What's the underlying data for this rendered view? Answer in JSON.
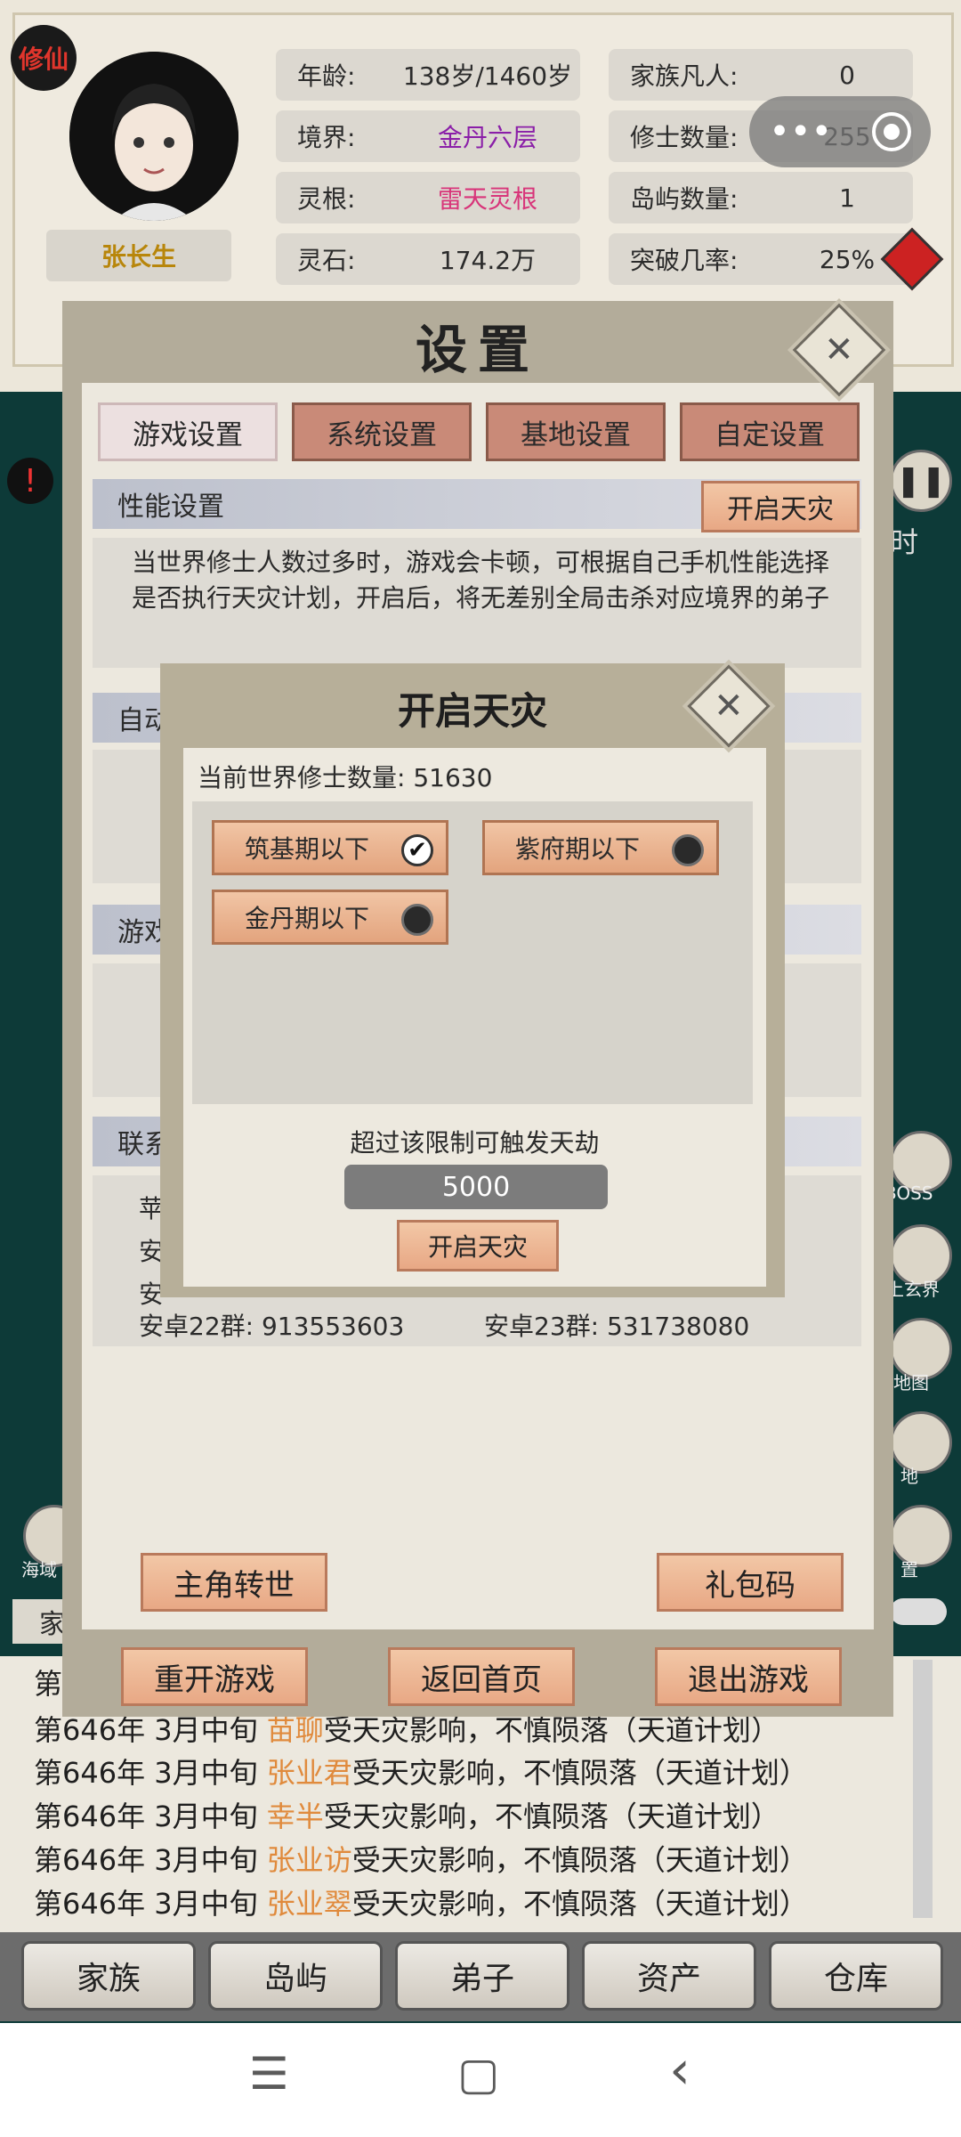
{
  "header": {
    "badge": "修仙",
    "player_name": "张长生",
    "stats": [
      {
        "key": "年龄:",
        "value": "138岁/1460岁"
      },
      {
        "key": "境界:",
        "value": "金丹六层"
      },
      {
        "key": "灵根:",
        "value": "雷天灵根"
      },
      {
        "key": "灵石:",
        "value": "174.2万"
      },
      {
        "key": "家族凡人:",
        "value": "0"
      },
      {
        "key": "修士数量:",
        "value": "255"
      },
      {
        "key": "岛屿数量:",
        "value": "1"
      },
      {
        "key": "突破几率:",
        "value": "25%"
      }
    ],
    "colors": {
      "realm": "#8a1ea8",
      "root": "#d8357a"
    }
  },
  "side": {
    "right_labels": [
      "BOSS",
      "上玄界",
      "地图",
      "地",
      "置"
    ],
    "left_label": "海域",
    "time_char": "时"
  },
  "settings": {
    "title": "设置",
    "tabs": [
      "游戏设置",
      "系统设置",
      "基地设置",
      "自定设置"
    ],
    "active_tab": 0,
    "perf_section": "性能设置",
    "perf_button": "开启天灾",
    "perf_desc": "当世界修士人数过多时，游戏会卡顿，可根据自己手机性能选择是否执行天灾计划，开启后，将无差别全局击杀对应境界的弟子",
    "hidden_sections": [
      "自动",
      "游戏",
      "联系"
    ],
    "contact_partial": [
      "苹",
      "安",
      "安"
    ],
    "qq_groups": [
      "安卓22群: 913553603",
      "安卓23群: 531738080"
    ],
    "bottom_buttons": [
      "主角转世",
      "礼包码"
    ],
    "footer_buttons": [
      "重开游戏",
      "返回首页",
      "退出游戏"
    ]
  },
  "dialog": {
    "title": "开启天灾",
    "world_count": "当前世界修士数量: 51630",
    "options": [
      {
        "label": "筑基期以下",
        "checked": true
      },
      {
        "label": "紫府期以下",
        "checked": false
      },
      {
        "label": "金丹期以下",
        "checked": false
      }
    ],
    "limit_label": "超过该限制可触发天劫",
    "limit_value": "5000",
    "confirm": "开启天灾"
  },
  "log": {
    "tab_partial": "家",
    "lines": [
      {
        "prefix": "第",
        "name": "",
        "suffix": ""
      },
      {
        "prefix": "第646年   3月中旬 ",
        "name": "苗聊",
        "suffix": "受天灾影响，不慎陨落（天道计划）"
      },
      {
        "prefix": "第646年   3月中旬 ",
        "name": "张业君",
        "suffix": "受天灾影响，不慎陨落（天道计划）"
      },
      {
        "prefix": "第646年   3月中旬 ",
        "name": "幸半",
        "suffix": "受天灾影响，不慎陨落（天道计划）"
      },
      {
        "prefix": "第646年   3月中旬 ",
        "name": "张业访",
        "suffix": "受天灾影响，不慎陨落（天道计划）"
      },
      {
        "prefix": "第646年   3月中旬 ",
        "name": "张业翠",
        "suffix": "受天灾影响，不慎陨落（天道计划）"
      }
    ]
  },
  "nav": [
    "家族",
    "岛屿",
    "弟子",
    "资产",
    "仓库"
  ],
  "system_bar": {
    "menu": "☰",
    "home": "▢",
    "back": "‹"
  }
}
